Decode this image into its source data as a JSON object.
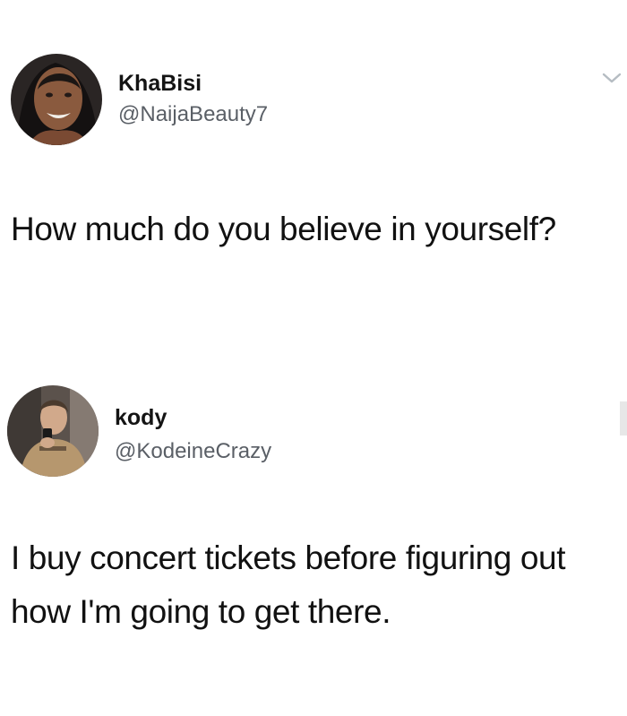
{
  "tweets": [
    {
      "display_name": "KhaBisi",
      "handle": "@NaijaBeauty7",
      "avatar_icon": "woman-portrait-avatar",
      "text": "How much do you believe in yourself?"
    },
    {
      "display_name": "kody",
      "handle": "@KodeineCrazy",
      "avatar_icon": "man-selfie-avatar",
      "text": "I buy concert tickets before figuring out how I'm going to get there."
    }
  ],
  "icons": {
    "menu": "chevron-down-icon"
  },
  "colors": {
    "background": "#ffffff",
    "text": "#111111",
    "handle": "#5a5f66",
    "chevron": "#b5bcc2"
  }
}
